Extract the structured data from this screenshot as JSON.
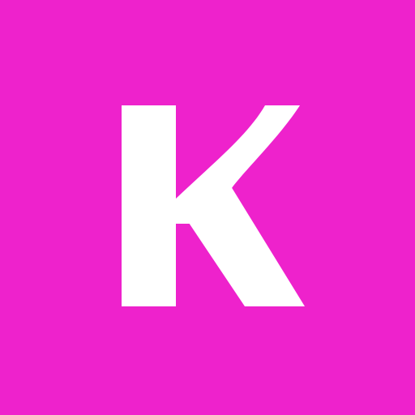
{
  "app_icon": {
    "letter": "K",
    "background_color": "#ee22cc",
    "letter_color": "#ffffff"
  }
}
